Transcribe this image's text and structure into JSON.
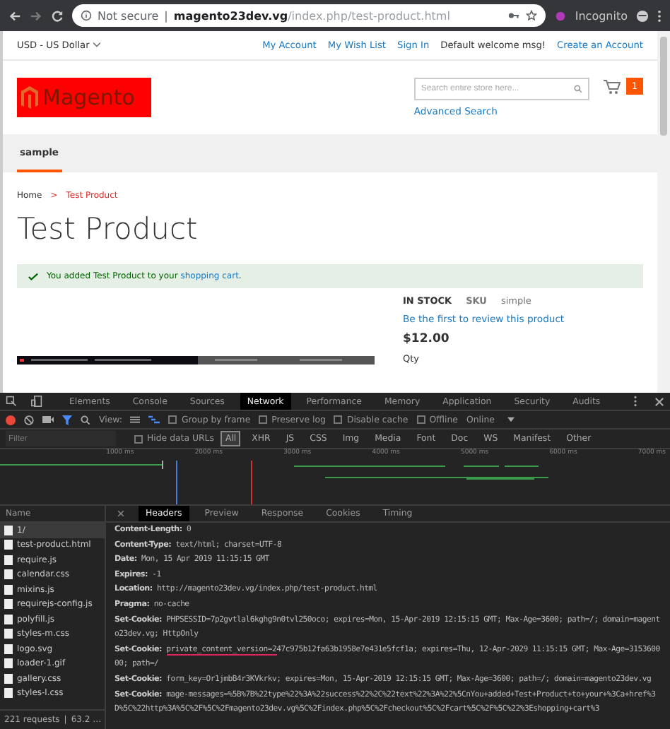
{
  "browser": {
    "security": "Not secure",
    "separator": "|",
    "host": "magento23dev.vg",
    "path": "/index.php/test-product.html",
    "mode": "Incognito"
  },
  "topbar": {
    "currency": "USD - US Dollar",
    "links": [
      {
        "label": "My Account",
        "kind": "link"
      },
      {
        "label": "My Wish List",
        "kind": "link"
      },
      {
        "label": "Sign In",
        "kind": "link"
      },
      {
        "label": "Default welcome msg!",
        "kind": "text"
      },
      {
        "label": "Create an Account",
        "kind": "link"
      }
    ]
  },
  "header": {
    "logo": "Magento",
    "search": {
      "placeholder": "Search entire store here..."
    },
    "advanced_search": "Advanced Search",
    "cart_count": "1"
  },
  "nav": [
    {
      "label": "sample",
      "selected": true
    }
  ],
  "breadcrumbs": [
    {
      "label": "Home",
      "current": false
    },
    {
      "label": "Test Product",
      "current": true
    }
  ],
  "breadcrumb_separator": ">",
  "title": "Test Product",
  "message": {
    "text": "You added Test Product to your",
    "link": "shopping cart",
    "end": "."
  },
  "product": {
    "stock": "IN STOCK",
    "sku_label": "SKU",
    "sku": "simple",
    "review": "Be the first to review this product",
    "price": "$12.00",
    "qty": "Qty"
  },
  "devtools": {
    "tabs": [
      {
        "label": "Elements",
        "selected": false
      },
      {
        "label": "Console",
        "selected": false
      },
      {
        "label": "Sources",
        "selected": false
      },
      {
        "label": "Network",
        "selected": true
      },
      {
        "label": "Performance",
        "selected": false
      },
      {
        "label": "Memory",
        "selected": false
      },
      {
        "label": "Application",
        "selected": false
      },
      {
        "label": "Security",
        "selected": false
      },
      {
        "label": "Audits",
        "selected": false
      }
    ],
    "view_label": "View:",
    "options": [
      {
        "label": "Group by frame",
        "checked": false
      },
      {
        "label": "Preserve log",
        "checked": false
      },
      {
        "label": "Disable cache",
        "checked": false
      },
      {
        "label": "Offline",
        "checked": false
      }
    ],
    "throttle": "Online",
    "filter": {
      "placeholder": "Filter"
    },
    "hide_data_urls": {
      "label": "Hide data URLs",
      "checked": false
    },
    "types": [
      {
        "label": "All",
        "selected": true
      },
      {
        "label": "XHR",
        "selected": false
      },
      {
        "label": "JS",
        "selected": false
      },
      {
        "label": "CSS",
        "selected": false
      },
      {
        "label": "Img",
        "selected": false
      },
      {
        "label": "Media",
        "selected": false
      },
      {
        "label": "Font",
        "selected": false
      },
      {
        "label": "Doc",
        "selected": false
      },
      {
        "label": "WS",
        "selected": false
      },
      {
        "label": "Manifest",
        "selected": false
      },
      {
        "label": "Other",
        "selected": false
      }
    ],
    "timeline_ticks": [
      "1000 ms",
      "2000 ms",
      "3000 ms",
      "4000 ms",
      "5000 ms",
      "6000 ms",
      "7000 ms"
    ],
    "name_column": "Name",
    "requests": [
      {
        "name": "1/",
        "selected": true
      },
      {
        "name": "test-product.html",
        "selected": false
      },
      {
        "name": "require.js",
        "selected": false
      },
      {
        "name": "calendar.css",
        "selected": false
      },
      {
        "name": "mixins.js",
        "selected": false
      },
      {
        "name": "requirejs-config.js",
        "selected": false
      },
      {
        "name": "polyfill.js",
        "selected": false
      },
      {
        "name": "styles-m.css",
        "selected": false
      },
      {
        "name": "logo.svg",
        "selected": false
      },
      {
        "name": "loader-1.gif",
        "selected": false
      },
      {
        "name": "gallery.css",
        "selected": false
      },
      {
        "name": "styles-l.css",
        "selected": false
      }
    ],
    "summary": [
      "221 requests",
      "|",
      "63.2 …"
    ],
    "detail_tabs": [
      {
        "label": "Headers",
        "selected": true
      },
      {
        "label": "Preview",
        "selected": false
      },
      {
        "label": "Response",
        "selected": false
      },
      {
        "label": "Cookies",
        "selected": false
      },
      {
        "label": "Timing",
        "selected": false
      }
    ],
    "headers": [
      {
        "name": "Content-Length:",
        "value": "0"
      },
      {
        "name": "Content-Type:",
        "value": "text/html; charset=UTF-8"
      },
      {
        "name": "Date:",
        "value": "Mon, 15 Apr 2019 11:15:15 GMT"
      },
      {
        "name": "Expires:",
        "value": "-1"
      },
      {
        "name": "Location:",
        "value": "http://magento23dev.vg/index.php/test-product.html"
      },
      {
        "name": "Pragma:",
        "value": "no-cache"
      },
      {
        "name": "Set-Cookie:",
        "value": "PHPSESSID=7p2gvtlal6kghg9n0tvl250oco; expires=Mon, 15-Apr-2019 12:15:15 GMT; Max-Age=3600; path=/; domain=magento23dev.vg; HttpOnly"
      },
      {
        "name": "Set-Cookie:",
        "marked": "private_content_version=2",
        "value": "47c975b12fa63b1958e7e431e5fcf1a; expires=Thu, 12-Apr-2029 11:15:15 GMT; Max-Age=315360000; path=/"
      },
      {
        "name": "Set-Cookie:",
        "value": "form_key=Or1jmbB4r3KVkrkv; expires=Mon, 15-Apr-2019 12:15:15 GMT; Max-Age=3600; path=/; domain=magento23dev.vg"
      },
      {
        "name": "Set-Cookie:",
        "value": "mage-messages=%5B%7B%22type%22%3A%22success%22%2C%22text%22%3A%22%5CnYou+added+Test+Product+to+your+%3Ca+href%3D%5C%22http%3A%5C%2F%5C%2Fmagento23dev.vg%5C%2Findex.php%5C%2Fcheckout%5C%2Fcart%5C%2F%5C%22%3Eshopping+cart%3"
      }
    ]
  }
}
